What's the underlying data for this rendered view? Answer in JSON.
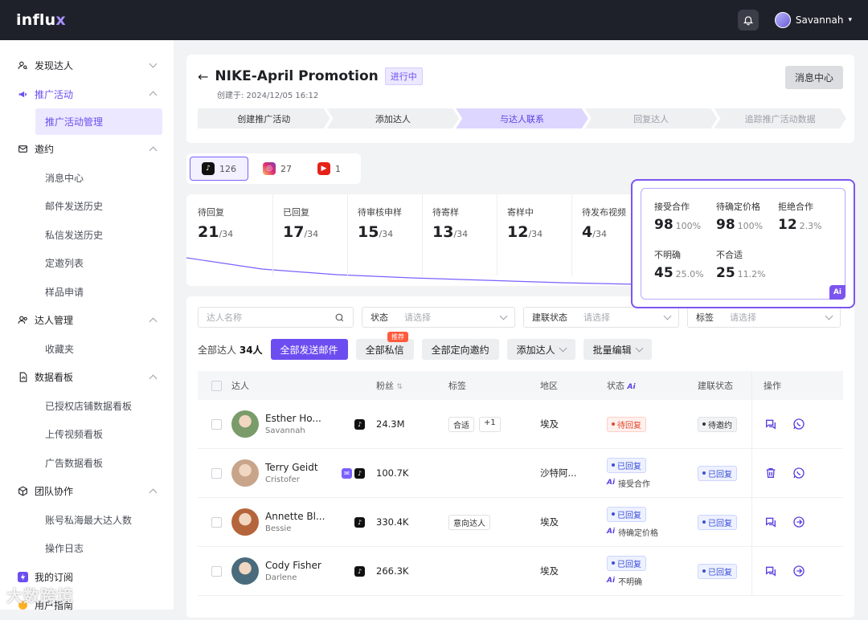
{
  "app": {
    "logo_text": "influx",
    "user": "Savannah"
  },
  "sidebar": {
    "groups": [
      {
        "label": "发现达人",
        "icon": "user-search-icon",
        "expanded": false,
        "items": []
      },
      {
        "label": "推广活动",
        "icon": "megaphone-icon",
        "expanded": true,
        "active": true,
        "items": [
          {
            "label": "推广活动管理",
            "active": true
          }
        ]
      },
      {
        "label": "邀约",
        "icon": "mail-icon",
        "expanded": true,
        "items": [
          {
            "label": "消息中心"
          },
          {
            "label": "邮件发送历史"
          },
          {
            "label": "私信发送历史"
          },
          {
            "label": "定邀列表"
          },
          {
            "label": "样品申请"
          }
        ]
      },
      {
        "label": "达人管理",
        "icon": "users-icon",
        "expanded": true,
        "items": [
          {
            "label": "收藏夹"
          }
        ]
      },
      {
        "label": "数据看板",
        "icon": "chart-icon",
        "expanded": true,
        "items": [
          {
            "label": "已授权店铺数据看板"
          },
          {
            "label": "上传视频看板"
          },
          {
            "label": "广告数据看板"
          }
        ]
      },
      {
        "label": "团队协作",
        "icon": "team-icon",
        "expanded": true,
        "items": [
          {
            "label": "账号私海最大达人数"
          },
          {
            "label": "操作日志"
          }
        ]
      },
      {
        "label": "我的订阅",
        "icon": "bolt-icon",
        "items": []
      },
      {
        "label": "用户指南",
        "icon": "hand-icon",
        "items": []
      }
    ]
  },
  "campaign": {
    "title": "NIKE-April Promotion",
    "status": "进行中",
    "created": "创建于: 2024/12/05 16:12",
    "msg_btn": "消息中心",
    "steps": [
      "创建推广活动",
      "添加达人",
      "与达人联系",
      "回复达人",
      "追踪推广活动数据"
    ],
    "current_step": 2
  },
  "platforms": [
    {
      "name": "TikTok",
      "count": "126",
      "icon": "tiktok-icon",
      "color": "#111111"
    },
    {
      "name": "Instagram",
      "count": "27",
      "icon": "instagram-icon",
      "color": "#e1306c"
    },
    {
      "name": "YouTube",
      "count": "1",
      "icon": "youtube-icon",
      "color": "#e62117"
    }
  ],
  "stats": [
    {
      "label": "待回复",
      "value": "21",
      "total": "/34"
    },
    {
      "label": "已回复",
      "value": "17",
      "total": "/34"
    },
    {
      "label": "待审核申样",
      "value": "15",
      "total": "/34"
    },
    {
      "label": "待寄样",
      "value": "13",
      "total": "/34"
    },
    {
      "label": "寄样中",
      "value": "12",
      "total": "/34"
    },
    {
      "label": "待发布视频",
      "value": "4",
      "total": "/34"
    }
  ],
  "ai_stats": [
    {
      "label": "接受合作",
      "value": "98",
      "pct": "100%"
    },
    {
      "label": "待确定价格",
      "value": "98",
      "pct": "100%"
    },
    {
      "label": "拒绝合作",
      "value": "12",
      "pct": "2.3%"
    },
    {
      "label": "不明确",
      "value": "45",
      "pct": "25.0%"
    },
    {
      "label": "不合适",
      "value": "25",
      "pct": "11.2%"
    }
  ],
  "ai_badge": "Ai",
  "filters": {
    "name_placeholder": "达人名称",
    "status_label": "状态",
    "status_placeholder": "请选择",
    "link_label": "建联状态",
    "link_placeholder": "请选择",
    "tag_label": "标签",
    "tag_placeholder": "请选择"
  },
  "actions": {
    "count_label": "全部达人",
    "count_value": "34人",
    "send_all": "全部发送邮件",
    "dm_all": "全部私信",
    "recommend": "推荐",
    "invite_all": "全部定向邀约",
    "add": "添加达人",
    "bulk": "批量编辑"
  },
  "table": {
    "headers": {
      "creator": "达人",
      "fans": "粉丝",
      "tags": "标签",
      "region": "地区",
      "status": "状态",
      "status_ai": "Ai",
      "link": "建联状态",
      "ops": "操作"
    },
    "rows": [
      {
        "name": "Esther Ho...",
        "sub": "Savannah",
        "fans": "24.3M",
        "tags": [
          "合适",
          "+1"
        ],
        "region": "埃及",
        "status": "待回复",
        "status_type": "wait",
        "ai": "",
        "link": "待邀约",
        "ops": [
          "chat-icon",
          "whatsapp-icon"
        ],
        "av": "#7a9b6a"
      },
      {
        "name": "Terry Geidt",
        "sub": "Cristofer",
        "fans": "100.7K",
        "tags": [],
        "region": "沙特阿...",
        "status": "已回复",
        "status_type": "rep",
        "ai": "接受合作",
        "link": "已回复",
        "ops": [
          "trash-icon",
          "whatsapp-icon"
        ],
        "av": "#c8a58a"
      },
      {
        "name": "Annette Bl...",
        "sub": "Bessie",
        "fans": "330.4K",
        "tags": [
          "意向达人"
        ],
        "region": "埃及",
        "status": "已回复",
        "status_type": "rep",
        "ai": "待确定价格",
        "link": "已回复",
        "ops": [
          "chat-icon",
          "arrow-right-icon"
        ],
        "av": "#b5653b"
      },
      {
        "name": "Cody Fisher",
        "sub": "Darlene",
        "fans": "266.3K",
        "tags": [],
        "region": "埃及",
        "status": "已回复",
        "status_type": "rep",
        "ai": "不明确",
        "link": "已回复",
        "ops": [
          "chat-icon",
          "arrow-right-icon"
        ],
        "av": "#4a6b7c"
      }
    ]
  },
  "watermark": "大数跨境"
}
